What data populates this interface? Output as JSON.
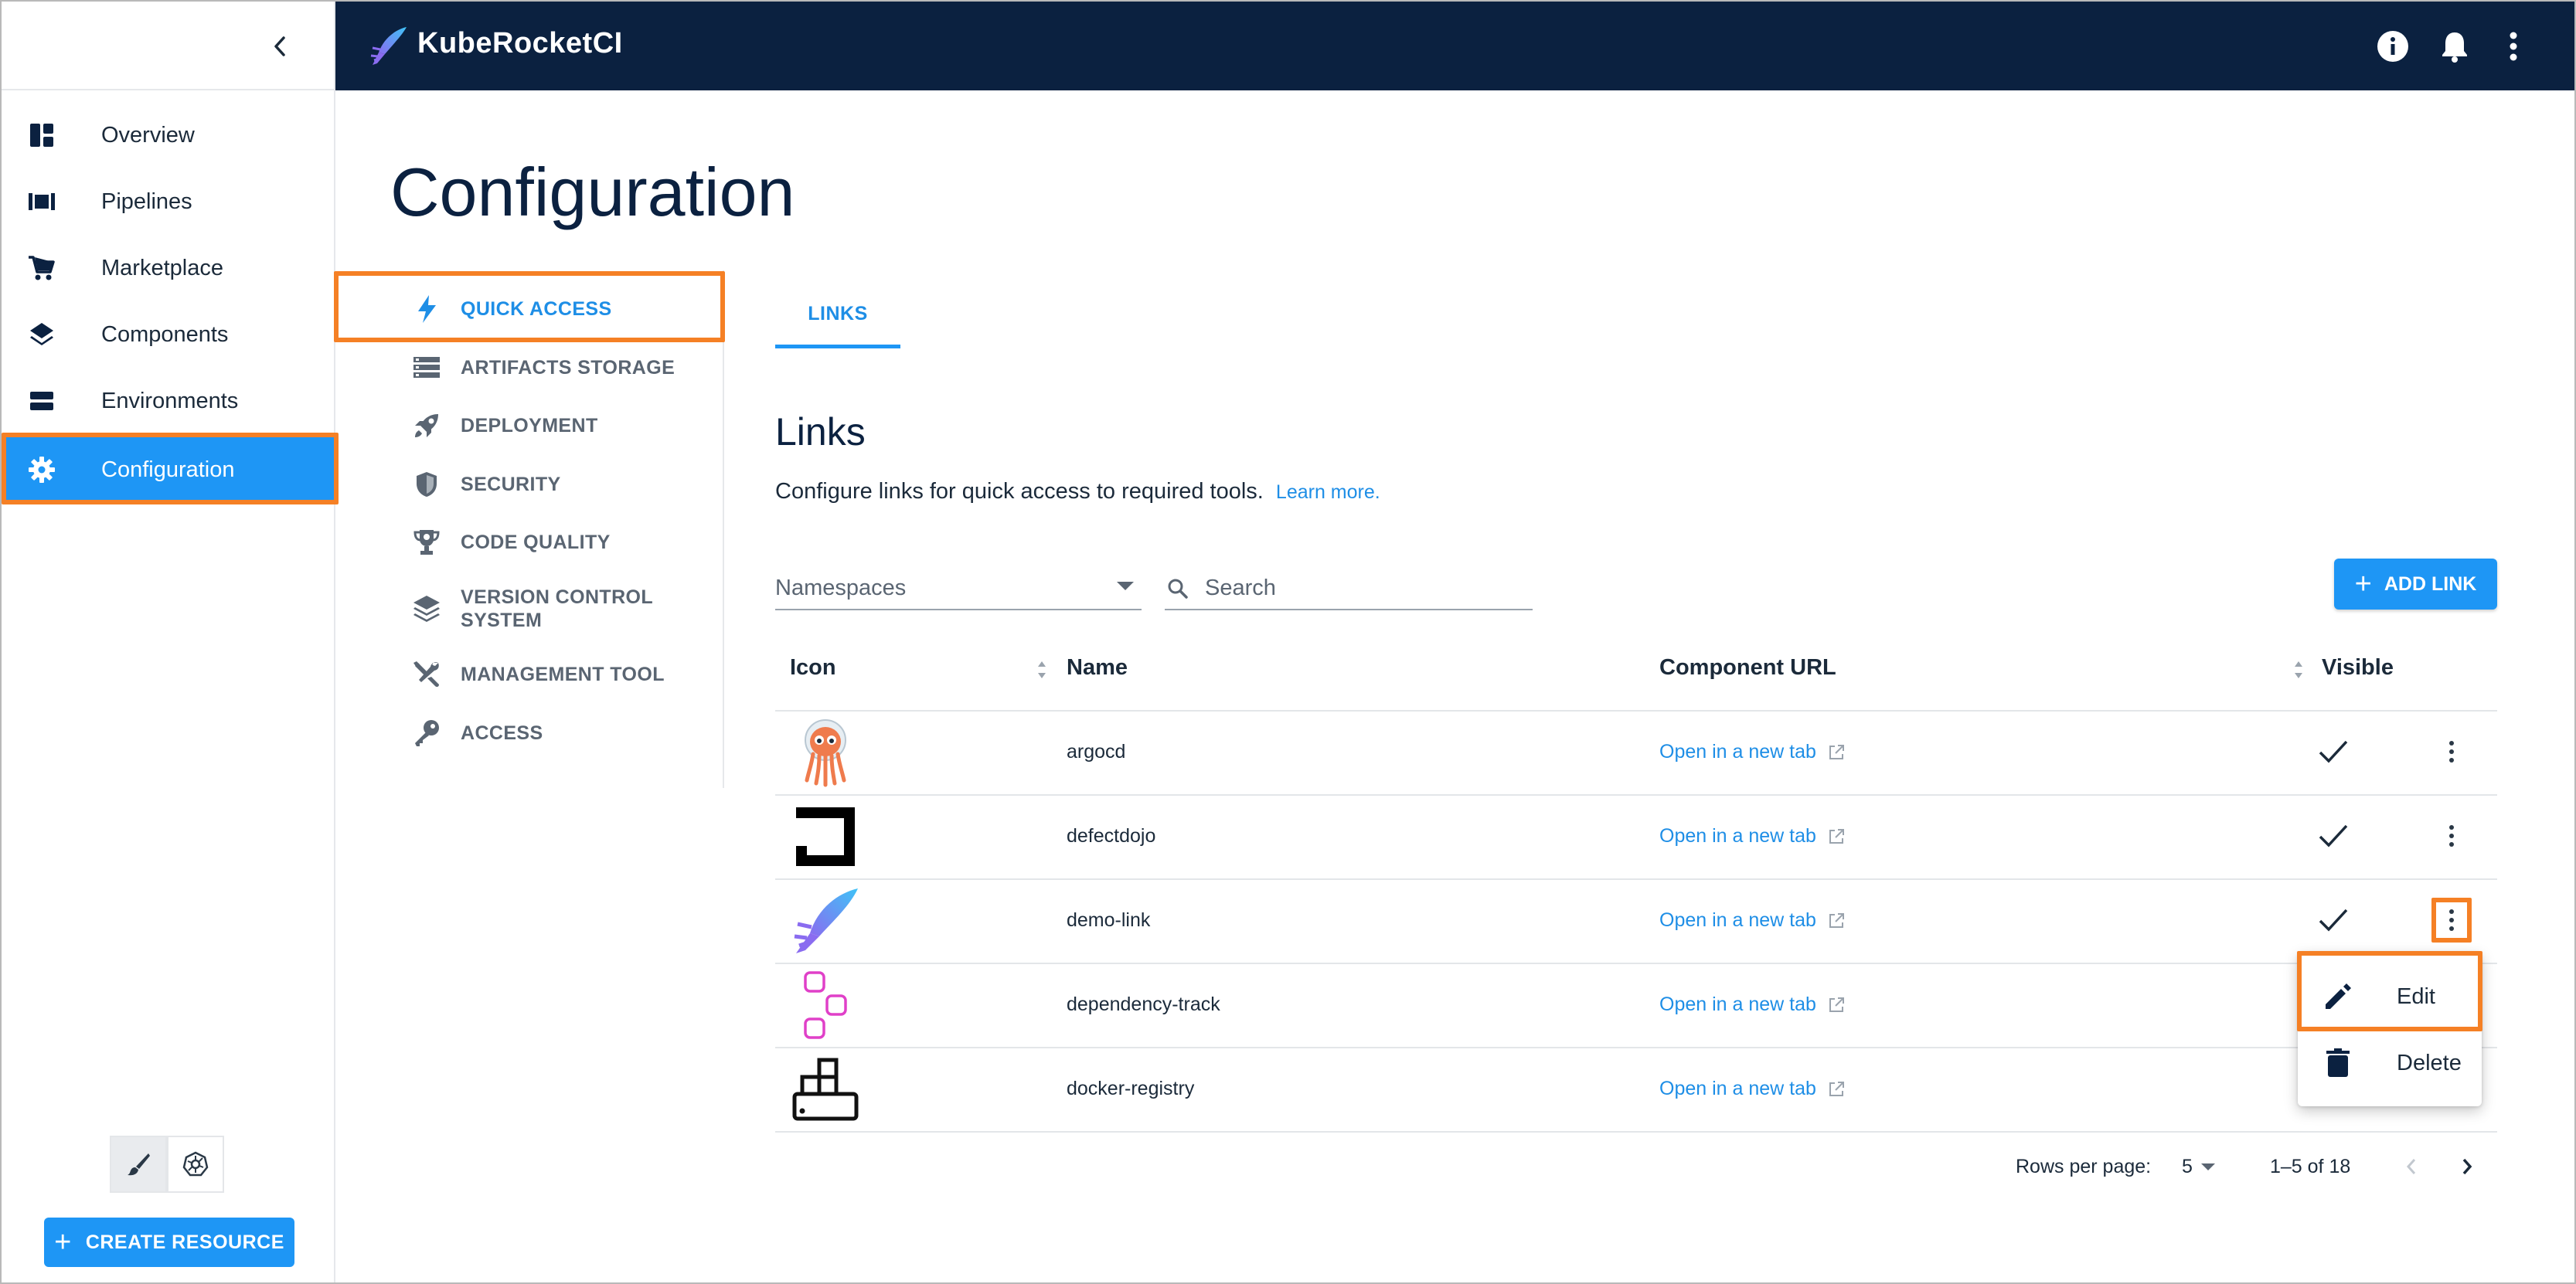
{
  "header": {
    "brand": "KubeRocketCI",
    "icons": [
      "info-icon",
      "bell-icon",
      "more-vert-icon"
    ],
    "background": "#0b2140"
  },
  "sidebar": {
    "items": [
      {
        "label": "Overview",
        "icon": "dashboard-icon"
      },
      {
        "label": "Pipelines",
        "icon": "pipelines-icon"
      },
      {
        "label": "Marketplace",
        "icon": "cart-icon"
      },
      {
        "label": "Components",
        "icon": "layers-icon"
      },
      {
        "label": "Environments",
        "icon": "environments-icon"
      },
      {
        "label": "Configuration",
        "icon": "gear-icon",
        "active": true
      }
    ],
    "create_button": "CREATE RESOURCE",
    "accent": "#1e96f5"
  },
  "page": {
    "title": "Configuration"
  },
  "subnav": {
    "items": [
      {
        "label": "QUICK ACCESS",
        "icon": "bolt-icon",
        "active": true
      },
      {
        "label": "ARTIFACTS STORAGE",
        "icon": "storage-icon"
      },
      {
        "label": "DEPLOYMENT",
        "icon": "rocket-icon"
      },
      {
        "label": "SECURITY",
        "icon": "shield-icon"
      },
      {
        "label": "CODE QUALITY",
        "icon": "trophy-icon"
      },
      {
        "label": "VERSION CONTROL SYSTEM",
        "label_line1": "VERSION CONTROL",
        "label_line2": "SYSTEM",
        "icon": "stack-icon"
      },
      {
        "label": "MANAGEMENT TOOL",
        "icon": "tools-icon"
      },
      {
        "label": "ACCESS",
        "icon": "key-icon"
      }
    ]
  },
  "tabs": [
    {
      "label": "LINKS",
      "active": true
    }
  ],
  "links": {
    "title": "Links",
    "description": "Configure links for quick access to required tools.",
    "learn_more": "Learn more.",
    "namespaces_placeholder": "Namespaces",
    "search_placeholder": "Search",
    "add_button": "ADD LINK",
    "columns": [
      "Icon",
      "Name",
      "Component URL",
      "Visible"
    ],
    "rows": [
      {
        "icon": "argocd-icon",
        "name": "argocd",
        "url_text": "Open in a new tab",
        "visible": true
      },
      {
        "icon": "defectdojo-icon",
        "name": "defectdojo",
        "url_text": "Open in a new tab",
        "visible": true
      },
      {
        "icon": "kuberocketci-icon",
        "name": "demo-link",
        "url_text": "Open in a new tab",
        "visible": true
      },
      {
        "icon": "dependency-track-icon",
        "name": "dependency-track",
        "url_text": "Open in a new tab",
        "visible": false
      },
      {
        "icon": "docker-registry-icon",
        "name": "docker-registry",
        "url_text": "Open in a new tab",
        "visible": false
      }
    ],
    "menu": [
      {
        "label": "Edit",
        "icon": "pencil-icon"
      },
      {
        "label": "Delete",
        "icon": "trash-icon"
      }
    ],
    "pagination": {
      "rows_per_page_label": "Rows per page:",
      "rows_per_page": "5",
      "range": "1–5 of 18"
    }
  },
  "highlight_color": "#f58025"
}
